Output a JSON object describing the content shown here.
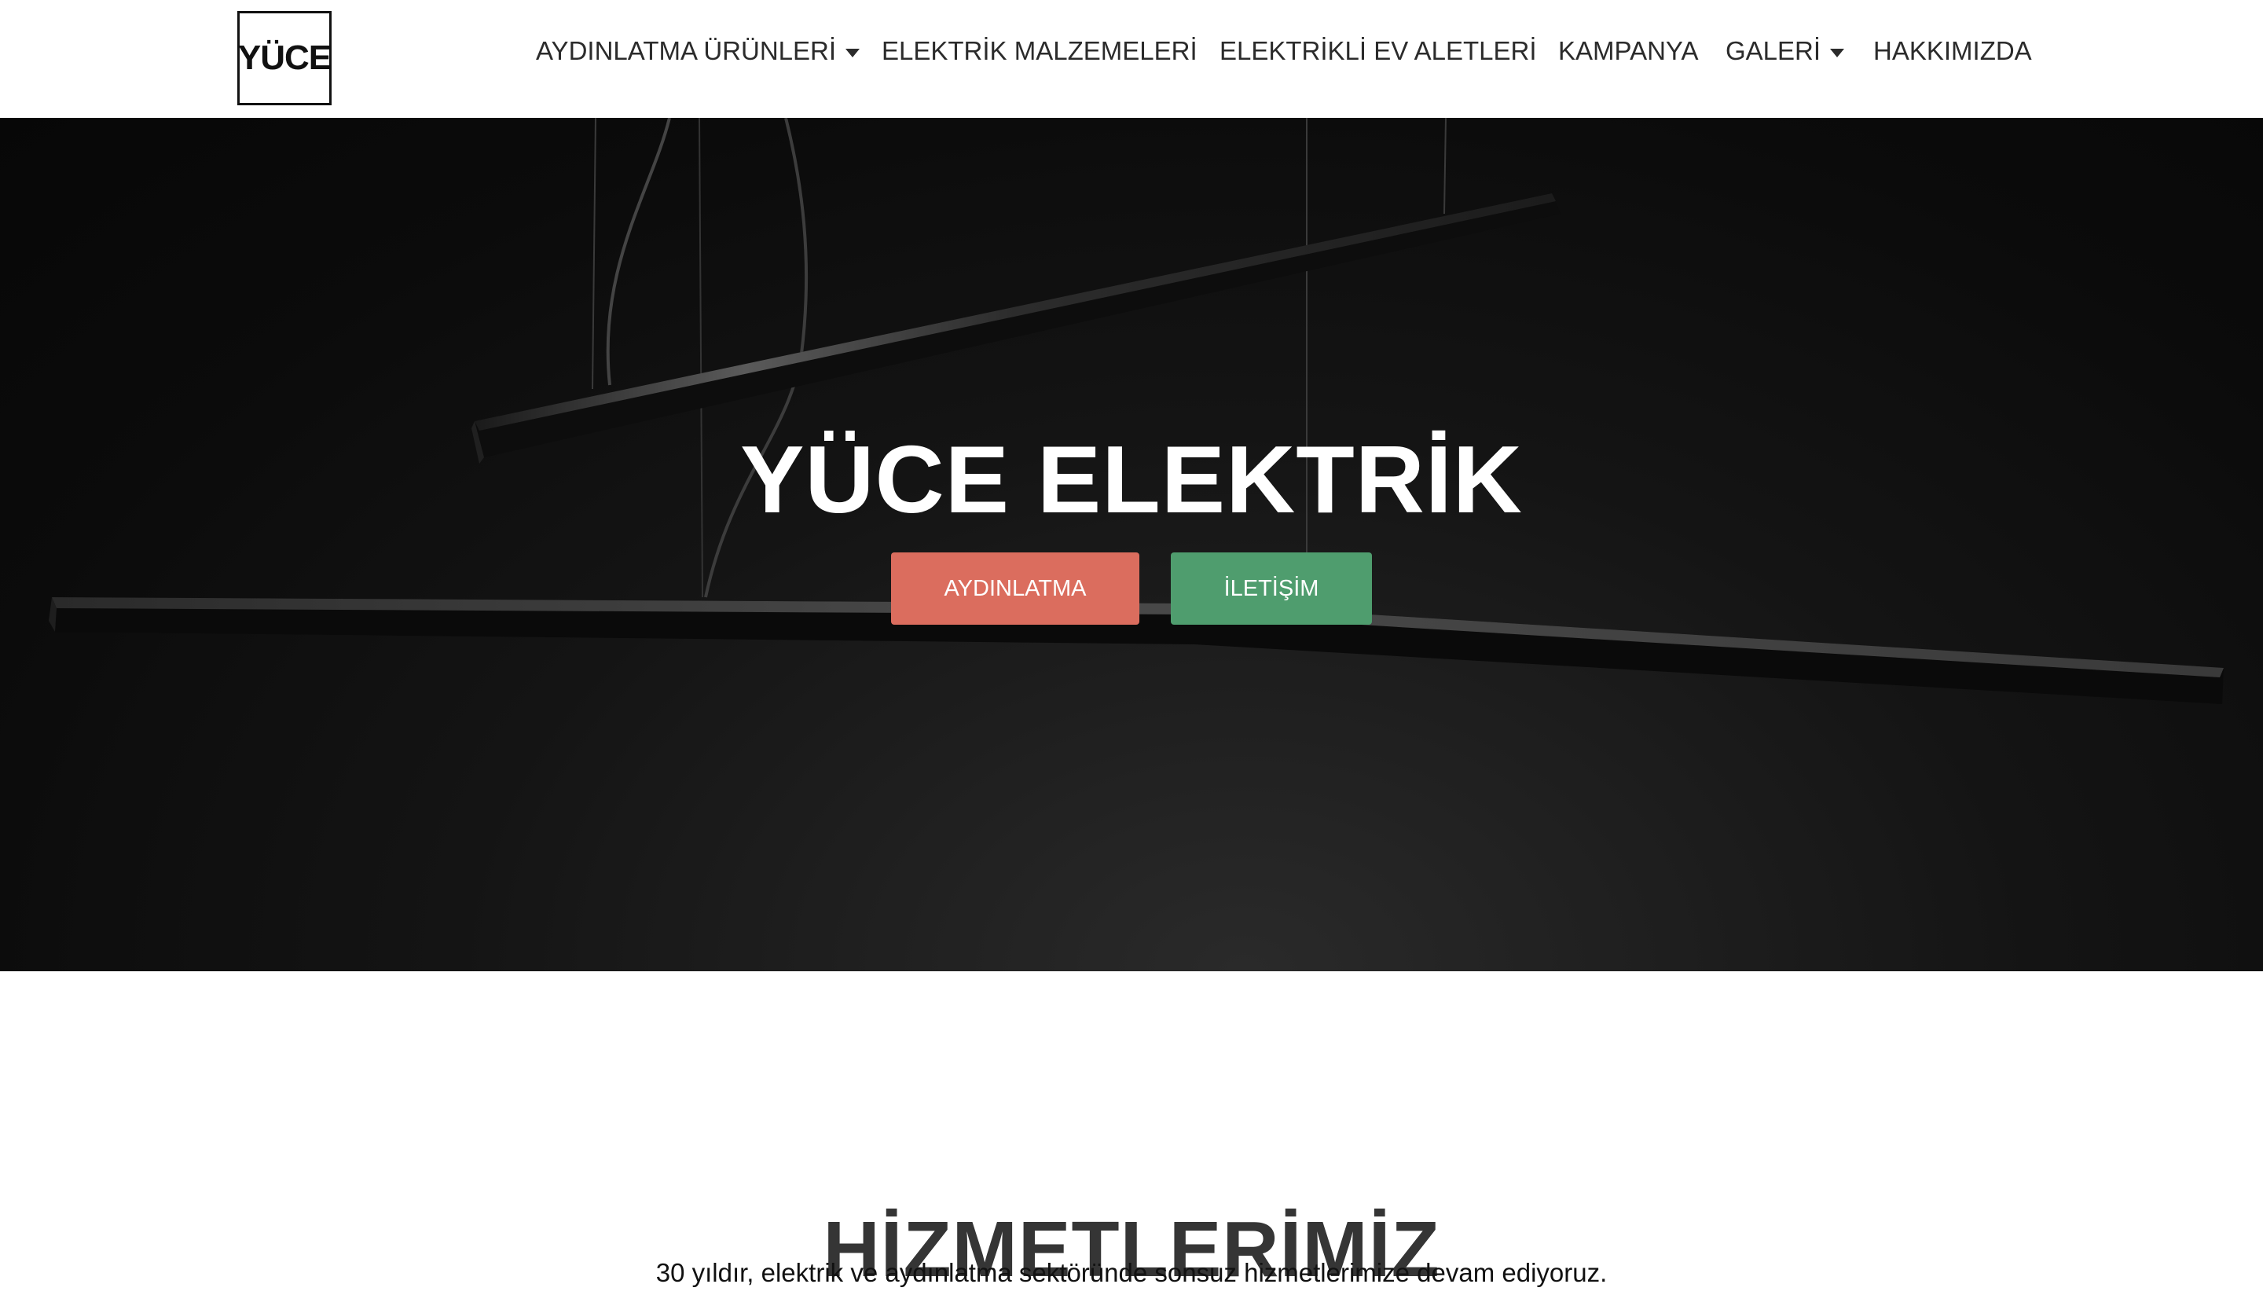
{
  "header": {
    "logo_text": "YÜCE",
    "nav": [
      {
        "label": "AYDINLATMA ÜRÜNLERİ",
        "has_dropdown": true
      },
      {
        "label": "ELEKTRİK MALZEMELERİ",
        "has_dropdown": false
      },
      {
        "label": "ELEKTRİKLİ EV ALETLERİ",
        "has_dropdown": false
      },
      {
        "label": "KAMPANYA",
        "has_dropdown": false
      },
      {
        "label": "GALERİ",
        "has_dropdown": true
      },
      {
        "label": "HAKKIMIZDA",
        "has_dropdown": false
      }
    ]
  },
  "hero": {
    "title": "YÜCE ELEKTRİK",
    "buttons": {
      "lighting": "AYDINLATMA",
      "contact": "İLETİŞİM"
    }
  },
  "services": {
    "title": "HİZMETLERİMİZ",
    "subtitle": "30 yıldır, elektrik ve aydınlatma sektöründe sonsuz hizmetlerimize devam ediyoruz."
  },
  "colors": {
    "lighting_button": "#db6d5e",
    "contact_button": "#4f9d6e",
    "hero_background": "#0b0b0b",
    "nav_text": "#2b2b2b"
  },
  "icons": {
    "dropdown": "caret-down-icon"
  }
}
